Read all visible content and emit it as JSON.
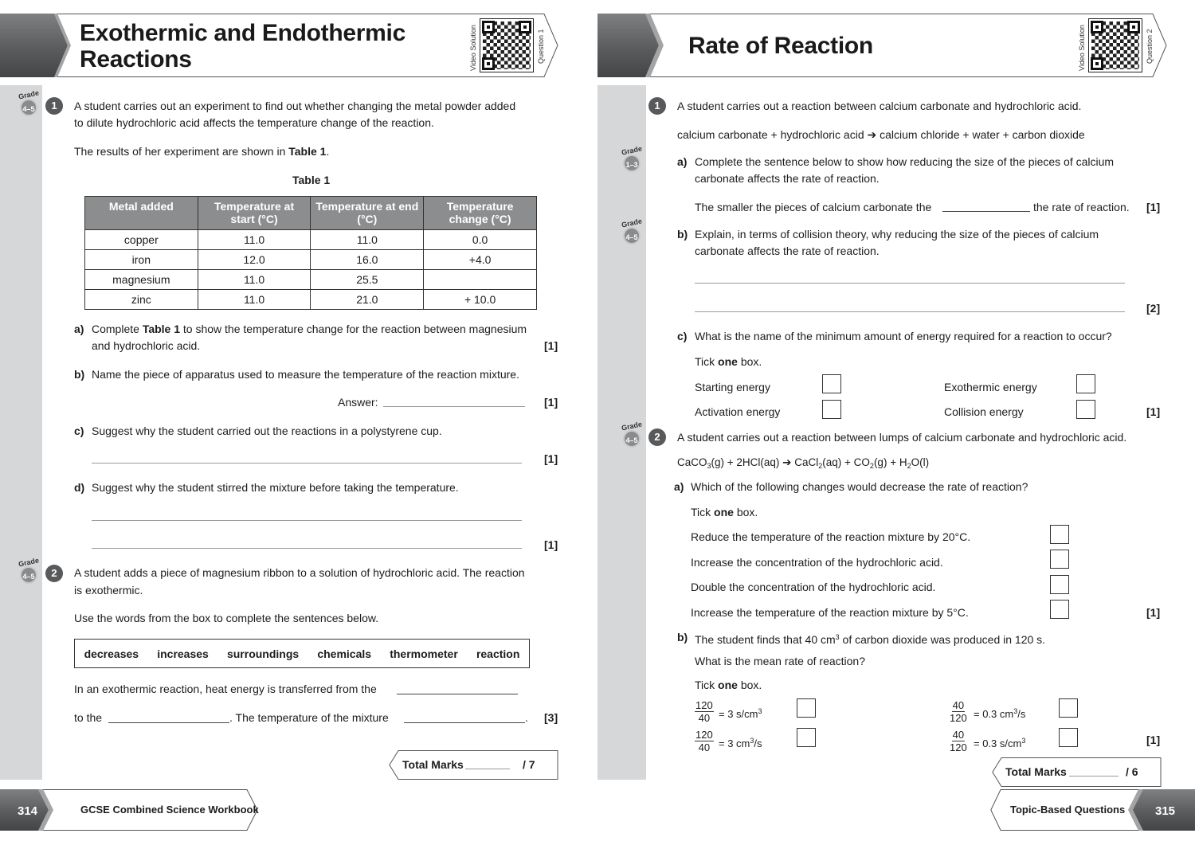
{
  "left_page": {
    "title_line1": "Exothermic and Endothermic",
    "title_line2": "Reactions",
    "video_label": "Video Solution",
    "question_label": "Question 1",
    "q1": {
      "grade_word": "Grade",
      "grade": "4–5",
      "number": "1",
      "intro_line1": "A student carries out an experiment to find out whether changing the metal powder added",
      "intro_line2": "to dilute hydrochloric acid affects the temperature change of the reaction.",
      "results_pre": "The results of her experiment are shown in ",
      "results_bold": "Table 1",
      "results_post": ".",
      "table_caption": "Table 1",
      "table": {
        "headers": [
          "Metal added",
          "Temperature at start (°C)",
          "Temperature at end (°C)",
          "Temperature change (°C)"
        ],
        "rows": [
          [
            "copper",
            "11.0",
            "11.0",
            "0.0"
          ],
          [
            "iron",
            "12.0",
            "16.0",
            "+4.0"
          ],
          [
            "magnesium",
            "11.0",
            "25.5",
            ""
          ],
          [
            "zinc",
            "11.0",
            "21.0",
            "+ 10.0"
          ]
        ]
      },
      "a_label": "a)",
      "a_pre": "Complete ",
      "a_bold": "Table 1",
      "a_post": " to show the temperature change for the reaction between magnesium",
      "a_line2": "and hydrochloric acid.",
      "a_mark": "[1]",
      "b_label": "b)",
      "b_text": "Name the piece of apparatus used to measure the temperature of the reaction mixture.",
      "b_answer": "Answer:",
      "b_mark": "[1]",
      "c_label": "c)",
      "c_text": "Suggest why the student carried out the reactions in a polystyrene cup.",
      "c_mark": "[1]",
      "d_label": "d)",
      "d_text": "Suggest why the student stirred the mixture before taking the temperature.",
      "d_mark": "[1]"
    },
    "q2": {
      "grade_word": "Grade",
      "grade": "4–5",
      "number": "2",
      "intro_line1": "A student adds a piece of magnesium ribbon to a solution of hydrochloric acid. The reaction",
      "intro_line2": "is exothermic.",
      "instruction": "Use the words from the box to complete the sentences below.",
      "words": [
        "decreases",
        "increases",
        "surroundings",
        "chemicals",
        "thermometer",
        "reaction"
      ],
      "sentence1": "In an exothermic reaction, heat energy is transferred from the",
      "sentence2_a": "to the",
      "sentence2_b": ". The temperature of the mixture",
      "sentence2_c": ".",
      "mark": "[3]"
    },
    "total_marks_label": "Total Marks",
    "total_marks_out_of": "/ 7",
    "page_number": "314",
    "footer_title": "GCSE Combined Science Workbook"
  },
  "right_page": {
    "title": "Rate of Reaction",
    "video_label": "Video Solution",
    "question_label": "Question 2",
    "q1": {
      "number": "1",
      "intro": "A student carries out a reaction between calcium carbonate and hydrochloric acid.",
      "word_equation": "calcium carbonate + hydrochloric acid ➔ calcium chloride + water + carbon dioxide",
      "a_grade_word": "Grade",
      "a_grade": "1–3",
      "a_label": "a)",
      "a_line1": "Complete the sentence below to show how reducing the size of the pieces of calcium",
      "a_line2": "carbonate affects the rate of reaction.",
      "a_sentence_pre": "The smaller the pieces of calcium carbonate the",
      "a_sentence_post": "the rate of reaction.",
      "a_mark": "[1]",
      "b_grade_word": "Grade",
      "b_grade": "4–5",
      "b_label": "b)",
      "b_line1": "Explain, in terms of collision theory, why reducing the size of the pieces of calcium",
      "b_line2": "carbonate affects the rate of reaction.",
      "b_mark": "[2]",
      "c_label": "c)",
      "c_text": "What is the name of the minimum amount of energy required for a reaction to occur?",
      "tick_pre": "Tick ",
      "tick_bold": "one",
      "tick_post": " box.",
      "c_options": [
        "Starting energy",
        "Exothermic energy",
        "Activation energy",
        "Collision energy"
      ],
      "c_mark": "[1]"
    },
    "q2": {
      "grade_word": "Grade",
      "grade": "4–5",
      "number": "2",
      "intro": "A student carries out a reaction between lumps of calcium carbonate and hydrochloric acid.",
      "equation": {
        "p1": "CaCO",
        "s1": "3",
        "p2": "(g) + 2HCl(aq) ➔ CaCl",
        "s2": "2",
        "p3": "(aq) + CO",
        "s3": "2",
        "p4": "(g) + H",
        "s4": "2",
        "p5": "O(l)"
      },
      "a_label": "a)",
      "a_text": "Which of the following changes would decrease the rate of reaction?",
      "tick_pre": "Tick ",
      "tick_bold": "one",
      "tick_post": " box.",
      "a_options": [
        "Reduce the temperature of the reaction mixture by 20°C.",
        "Increase the concentration of the hydrochloric acid.",
        "Double the concentration of the hydrochloric acid.",
        "Increase the temperature of the reaction mixture by 5°C."
      ],
      "a_mark": "[1]",
      "b_label": "b)",
      "b_pre": "The student finds that 40 cm",
      "b_sup": "3",
      "b_post": " of carbon dioxide was produced in 120 s.",
      "b_question": "What is the mean rate of reaction?",
      "b_options": [
        {
          "num": "120",
          "den": "40",
          "result": "= 3 s/cm",
          "sup": "3",
          "tail": ""
        },
        {
          "num": "40",
          "den": "120",
          "result": "= 0.3 cm",
          "sup": "3",
          "tail": "/s"
        },
        {
          "num": "120",
          "den": "40",
          "result": "= 3 cm",
          "sup": "3",
          "tail": "/s"
        },
        {
          "num": "40",
          "den": "120",
          "result": "= 0.3 s/cm",
          "sup": "3",
          "tail": ""
        }
      ],
      "b_mark": "[1]"
    },
    "total_marks_label": "Total Marks",
    "total_marks_out_of": "/ 6",
    "page_number": "315",
    "footer_title": "Topic-Based Questions"
  }
}
